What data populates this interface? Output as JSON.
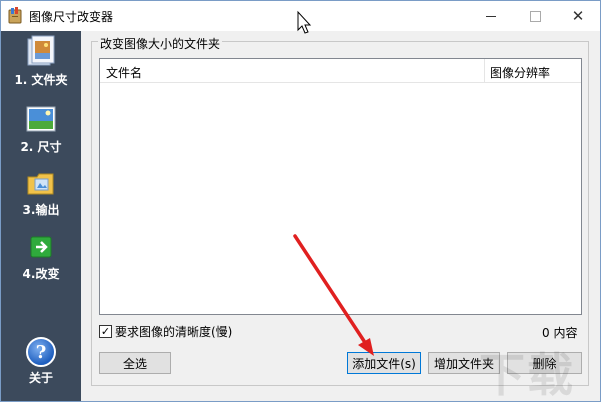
{
  "window": {
    "title": "图像尺寸改变器",
    "close_glyph": "✕"
  },
  "sidebar": {
    "items": [
      {
        "label": "1. 文件夹",
        "icon": "folder-images-icon"
      },
      {
        "label": "2. 尺寸",
        "icon": "picture-size-icon"
      },
      {
        "label": "3.输出",
        "icon": "output-folder-icon"
      },
      {
        "label": "4.改变",
        "icon": "green-arrow-icon"
      }
    ],
    "about": {
      "label": "关于",
      "glyph": "?",
      "icon": "help-icon"
    }
  },
  "main": {
    "group_title": "改变图像大小的文件夹",
    "columns": [
      "文件名",
      "图像分辨率"
    ],
    "rows": [],
    "checkbox": {
      "label": "要求图像的清晰度(慢)",
      "checked": true,
      "mark": "✓"
    },
    "count_text": "0 内容",
    "buttons": {
      "select_all": "全选",
      "add_files": "添加文件(s)",
      "add_folder": "增加文件夹",
      "delete": "删除"
    }
  },
  "watermark": {
    "text": "下载"
  },
  "colors": {
    "sidebar_bg": "#3c4a5c",
    "window_bg": "#f0f0f0",
    "annotation_arrow": "#e02020",
    "focus_border": "#0078d7"
  }
}
